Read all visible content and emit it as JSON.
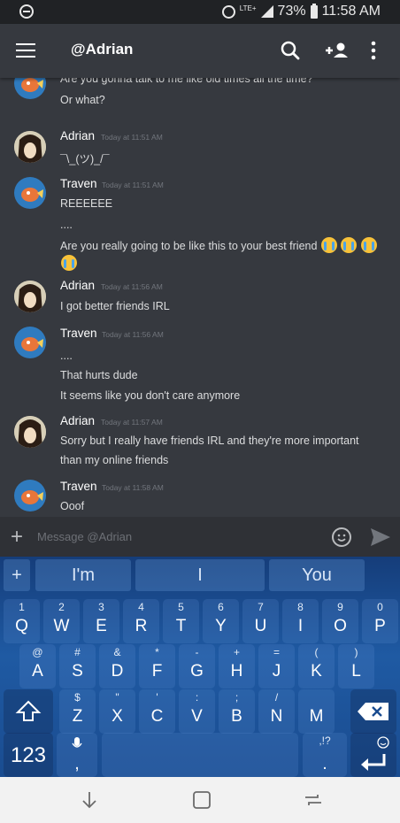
{
  "status_bar": {
    "network": "LTE+",
    "battery": "73%",
    "time": "11:58 AM"
  },
  "app_bar": {
    "title": "@Adrian"
  },
  "messages": [
    {
      "author": "",
      "timestamp": "",
      "avatar": "traven",
      "lines": [
        "Are you gonna talk to me like old times all the time?",
        "Or what?"
      ]
    },
    {
      "author": "Adrian",
      "timestamp": "Today at 11:51 AM",
      "avatar": "adrian",
      "lines": [
        "¯\\_(ツ)_/¯"
      ]
    },
    {
      "author": "Traven",
      "timestamp": "Today at 11:51 AM",
      "avatar": "traven",
      "lines": [
        "REEEEEE",
        "....",
        "Are you really going to be like this to your best friend"
      ]
    },
    {
      "author": "Adrian",
      "timestamp": "Today at 11:56 AM",
      "avatar": "adrian",
      "lines": [
        "I got better friends IRL"
      ]
    },
    {
      "author": "Traven",
      "timestamp": "Today at 11:56 AM",
      "avatar": "traven",
      "lines": [
        "....",
        "That hurts dude",
        "It seems like you don't care anymore"
      ]
    },
    {
      "author": "Adrian",
      "timestamp": "Today at 11:57 AM",
      "avatar": "adrian",
      "lines": [
        "Sorry but I really have friends IRL and they're more important",
        "than my online friends"
      ]
    },
    {
      "author": "Traven",
      "timestamp": "Today at 11:58 AM",
      "avatar": "traven",
      "lines": [
        "Ooof"
      ]
    }
  ],
  "composer": {
    "placeholder": "Message @Adrian"
  },
  "keyboard": {
    "suggestions": [
      "+",
      "I'm",
      "I",
      "You"
    ],
    "row1": [
      [
        "1",
        "Q"
      ],
      [
        "2",
        "W"
      ],
      [
        "3",
        "E"
      ],
      [
        "4",
        "R"
      ],
      [
        "5",
        "T"
      ],
      [
        "6",
        "Y"
      ],
      [
        "7",
        "U"
      ],
      [
        "8",
        "I"
      ],
      [
        "9",
        "O"
      ],
      [
        "0",
        "P"
      ]
    ],
    "row2": [
      [
        "@",
        "A"
      ],
      [
        "#",
        "S"
      ],
      [
        "&",
        "D"
      ],
      [
        "*",
        "F"
      ],
      [
        "-",
        "G"
      ],
      [
        "+",
        "H"
      ],
      [
        "=",
        "J"
      ],
      [
        "(",
        "K"
      ],
      [
        ")",
        "L"
      ]
    ],
    "row3": [
      [
        "$",
        "Z"
      ],
      [
        "\"",
        "X"
      ],
      [
        "'",
        "C"
      ],
      [
        ":",
        "V"
      ],
      [
        ";",
        "B"
      ],
      [
        "/",
        "N"
      ],
      [
        "",
        "M"
      ]
    ],
    "row3_z_sub": "-",
    "numbers_label": "123",
    "mic_sub": ",",
    "punct_label": ",!?",
    "period_label": "."
  },
  "colors": {
    "background": "#36393f",
    "accent": "#7289da",
    "keyboard": "#1f5aa3"
  }
}
